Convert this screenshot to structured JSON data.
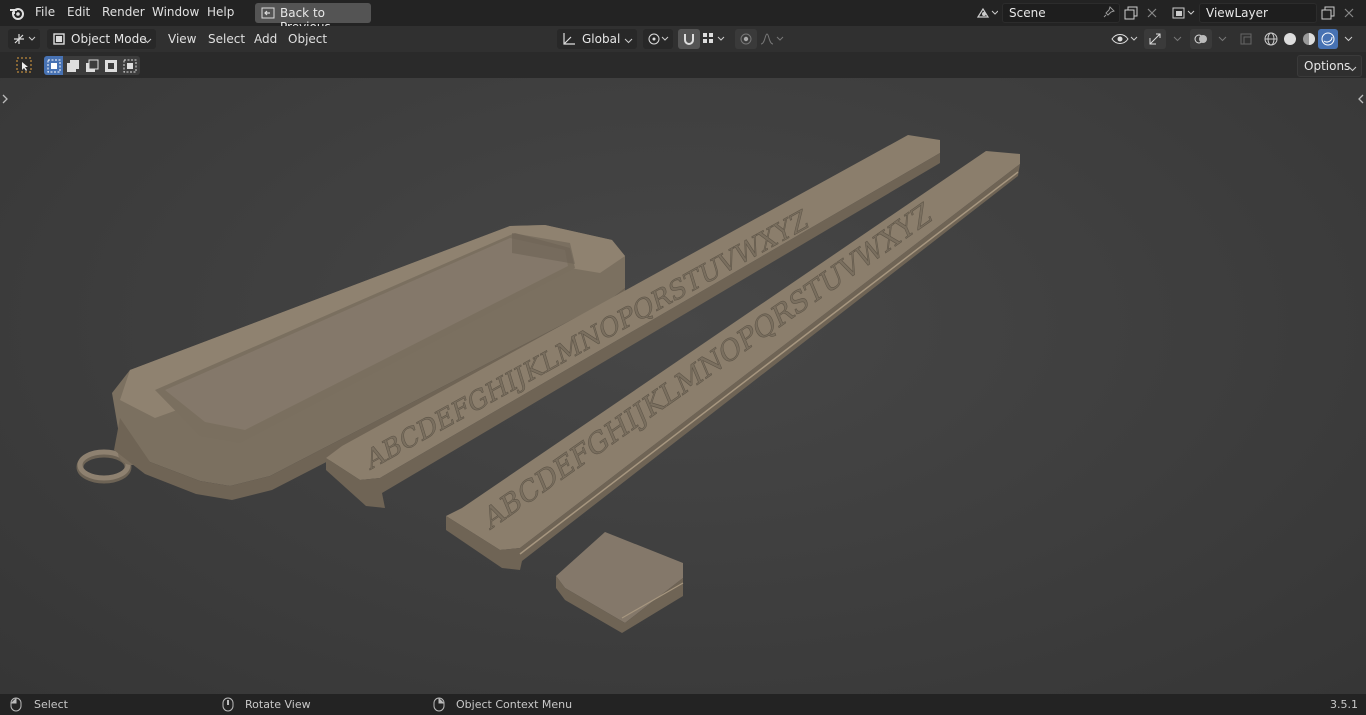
{
  "topbar": {
    "menus": [
      "File",
      "Edit",
      "Render",
      "Window",
      "Help"
    ],
    "back_button": "Back to Previous",
    "scene": {
      "label": "Scene"
    },
    "view_layer": {
      "label": "ViewLayer"
    }
  },
  "header": {
    "mode": "Object Mode",
    "menus": [
      "View",
      "Select",
      "Add",
      "Object"
    ],
    "transform_orientation": "Global",
    "options": "Options"
  },
  "status": {
    "select": "Select",
    "rotate": "Rotate View",
    "context_menu": "Object Context Menu",
    "version": "3.5.1"
  },
  "colors": {
    "model": "#867a6a",
    "model_shadow": "#6d6355",
    "model_light": "#988b79",
    "accent": "#4772b3"
  },
  "scene_objects": {
    "ruler_1_letters": "ABCDEFGHIJKLMNOPQRSTUVWXYZ",
    "ruler_2_letters": "ABCDEFGHIJKLMNOPQRSTUVWXYZ"
  }
}
